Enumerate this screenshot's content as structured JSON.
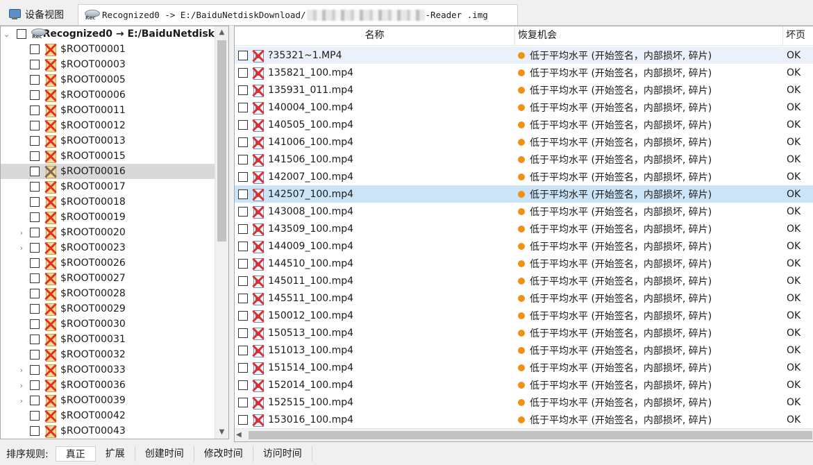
{
  "tabs": {
    "device_view": "设备视图",
    "recognized_prefix": "Recognized0 -> E:/BaiduNetdiskDownload/",
    "recognized_suffix": "-Reader .img"
  },
  "tree": {
    "root_label": "Recognized0 → E:/BaiduNetdisk",
    "items": [
      {
        "label": "$ROOT00001"
      },
      {
        "label": "$ROOT00003"
      },
      {
        "label": "$ROOT00005"
      },
      {
        "label": "$ROOT00006"
      },
      {
        "label": "$ROOT00011"
      },
      {
        "label": "$ROOT00012"
      },
      {
        "label": "$ROOT00013"
      },
      {
        "label": "$ROOT00015"
      },
      {
        "label": "$ROOT00016"
      },
      {
        "label": "$ROOT00017"
      },
      {
        "label": "$ROOT00018"
      },
      {
        "label": "$ROOT00019"
      },
      {
        "label": "$ROOT00020"
      },
      {
        "label": "$ROOT00023"
      },
      {
        "label": "$ROOT00026"
      },
      {
        "label": "$ROOT00027"
      },
      {
        "label": "$ROOT00028"
      },
      {
        "label": "$ROOT00029"
      },
      {
        "label": "$ROOT00030"
      },
      {
        "label": "$ROOT00031"
      },
      {
        "label": "$ROOT00032"
      },
      {
        "label": "$ROOT00033"
      },
      {
        "label": "$ROOT00036"
      },
      {
        "label": "$ROOT00039"
      },
      {
        "label": "$ROOT00042"
      },
      {
        "label": "$ROOT00043"
      }
    ],
    "selected_label": "$ROOT00016",
    "expandable": [
      "$ROOT00020",
      "$ROOT00023",
      "$ROOT00033",
      "$ROOT00036",
      "$ROOT00039"
    ]
  },
  "list": {
    "headers": {
      "name": "名称",
      "chance": "恢复机会",
      "damage": "坏页"
    },
    "chance_text": "低于平均水平 (开始签名，内部损坏, 碎片)",
    "damage_text": "OK",
    "chance_color": "#f29111",
    "highlighted_row": "142507_100.mp4",
    "files": [
      "?35321~1.MP4",
      "135821_100.mp4",
      "135931_011.mp4",
      "140004_100.mp4",
      "140505_100.mp4",
      "141006_100.mp4",
      "141506_100.mp4",
      "142007_100.mp4",
      "142507_100.mp4",
      "143008_100.mp4",
      "143509_100.mp4",
      "144009_100.mp4",
      "144510_100.mp4",
      "145011_100.mp4",
      "145511_100.mp4",
      "150012_100.mp4",
      "150513_100.mp4",
      "151013_100.mp4",
      "151514_100.mp4",
      "152014_100.mp4",
      "152515_100.mp4",
      "153016_100.mp4"
    ]
  },
  "sortbar": {
    "label": "排序规则:",
    "options": [
      "真正",
      "扩展",
      "创建时间",
      "修改时间",
      "访问时间"
    ],
    "active": "真正"
  }
}
